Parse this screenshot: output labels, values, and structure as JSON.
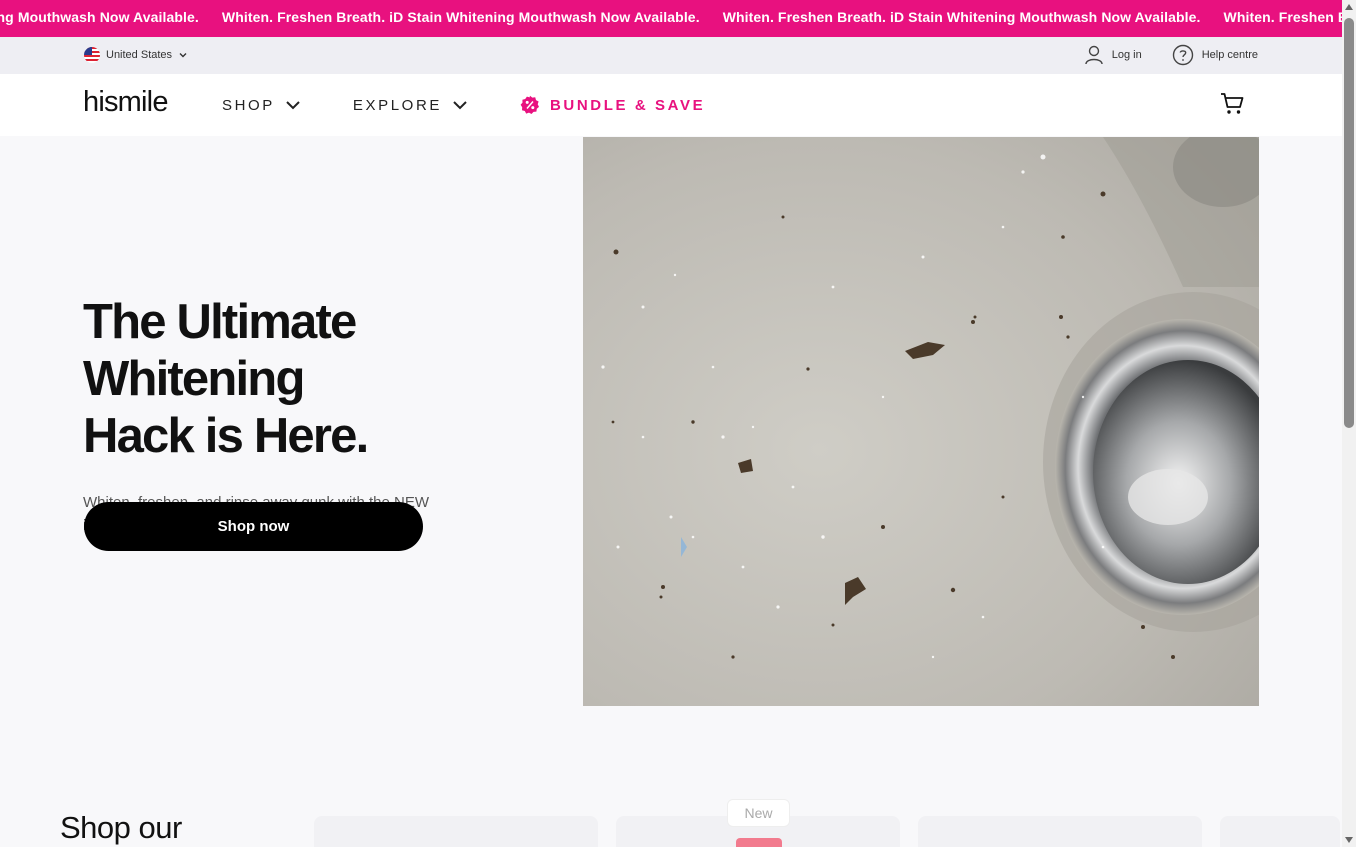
{
  "promo_banner": {
    "messages": [
      "ening Mouthwash Now Available.",
      "Whiten. Freshen Breath. iD Stain Whitening Mouthwash Now Available.",
      "Whiten. Freshen Breath. iD Stain Whitening Mouthwash Now Available.",
      "Whiten. Freshen Breath. iD Stain W"
    ],
    "background": "#e8117f"
  },
  "utility_bar": {
    "region_label": "United States",
    "login_label": "Log in",
    "help_label": "Help centre"
  },
  "nav": {
    "logo": "hismile",
    "items": [
      {
        "label": "SHOP"
      },
      {
        "label": "EXPLORE"
      },
      {
        "label": "BUNDLE & SAVE"
      }
    ],
    "accent": "#e8117f"
  },
  "hero": {
    "title_line1": "The Ultimate Whitening",
    "title_line2": "Hack is Here.",
    "subtitle": "Whiten, freshen, and rinse away gunk with the NEW iD Stain Whitening Mouthwash. Available NOW.",
    "cta_label": "Shop now"
  },
  "products_section": {
    "title": "Shop our",
    "new_badge": "New"
  },
  "icons": [
    "chevron-down-icon",
    "user-icon",
    "help-circle-icon",
    "discount-badge-icon",
    "cart-icon"
  ]
}
